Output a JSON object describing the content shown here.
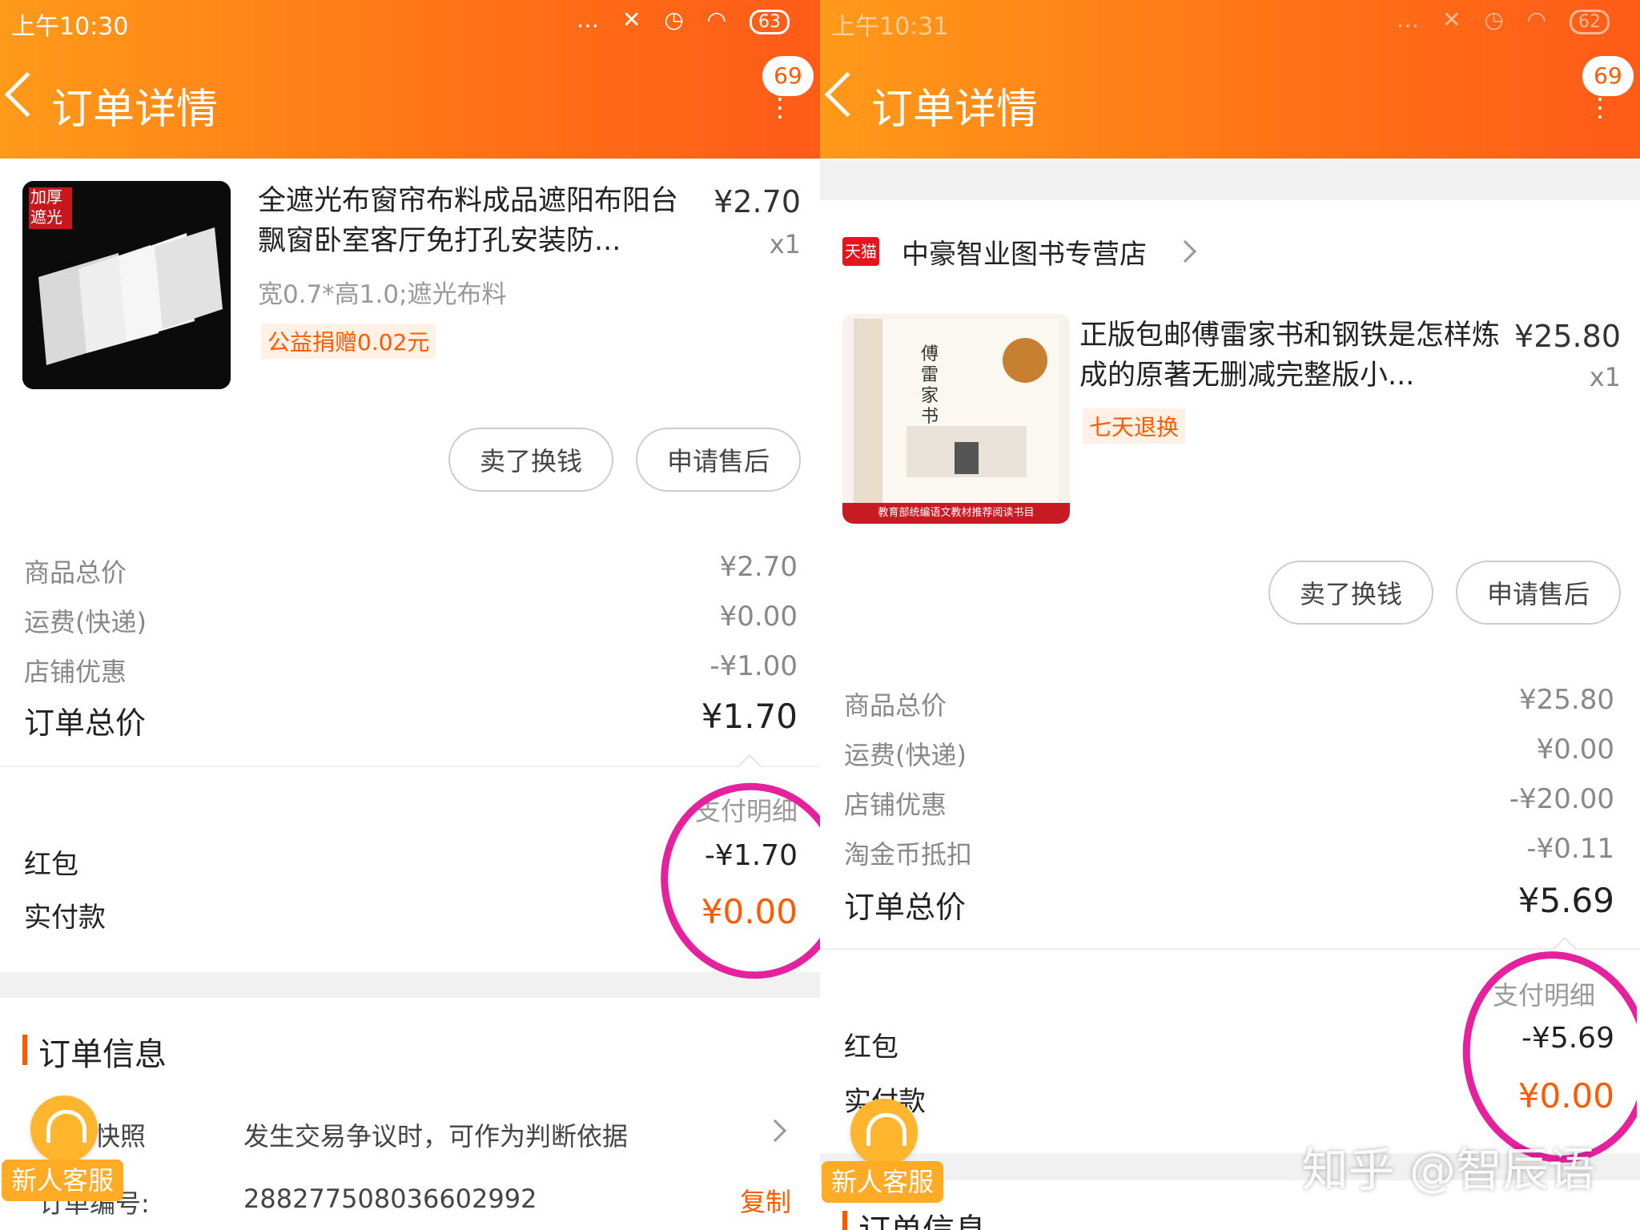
{
  "left": {
    "status": {
      "time": "上午10:30",
      "battery": "63"
    },
    "title": "订单详情",
    "badge": "69",
    "product": {
      "thumb_label": "加厚\n遮光",
      "title": "全遮光布窗帘布料成品遮阳布阳台飘窗卧室客厅免打孔安装防...",
      "price": "¥2.70",
      "qty": "x1",
      "sku": "宽0.7*高1.0;遮光布料",
      "tag": "公益捐赠0.02元"
    },
    "buttons": {
      "sell": "卖了换钱",
      "after_sale": "申请售后"
    },
    "summary": [
      {
        "label": "商品总价",
        "value": "¥2.70"
      },
      {
        "label": "运费(快递)",
        "value": "¥0.00"
      },
      {
        "label": "店铺优惠",
        "value": "-¥1.00"
      }
    ],
    "order_total": {
      "label": "订单总价",
      "value": "¥1.70"
    },
    "pay_detail_label": "支付明细",
    "red_packet": {
      "label": "红包",
      "value": "-¥1.70"
    },
    "actual_pay": {
      "label": "实付款",
      "value": "¥0.00"
    },
    "order_info_title": "订单信息",
    "snapshot": {
      "label": "快照",
      "desc": "发生交易争议时，可作为判断依据"
    },
    "order_no": {
      "label": "订单编号:",
      "value": "2882775080366029​92",
      "copy": "复制"
    },
    "customer_service": "新人客服"
  },
  "right": {
    "status": {
      "time": "上午10:31",
      "battery": "62"
    },
    "title": "订单详情",
    "badge": "69",
    "store": {
      "icon": "天猫",
      "name": "中豪智业图书专营店"
    },
    "product": {
      "title": "正版包邮傅雷家书和钢铁是怎样炼成的原著无删减完整版小...",
      "price": "¥25.80",
      "qty": "x1",
      "tag": "七天退换",
      "book_title": "傅雷家书",
      "book_banner": "教育部统编语文教材推荐阅读书目"
    },
    "buttons": {
      "sell": "卖了换钱",
      "after_sale": "申请售后"
    },
    "summary": [
      {
        "label": "商品总价",
        "value": "¥25.80"
      },
      {
        "label": "运费(快递)",
        "value": "¥0.00"
      },
      {
        "label": "店铺优惠",
        "value": "-¥20.00"
      },
      {
        "label": "淘金币抵扣",
        "value": "-¥0.11"
      }
    ],
    "order_total": {
      "label": "订单总价",
      "value": "¥5.69"
    },
    "pay_detail_label": "支付明细",
    "red_packet": {
      "label": "红包",
      "value": "-¥5.69"
    },
    "actual_pay": {
      "label": "实付款",
      "value": "¥0.00"
    },
    "order_info_title": "订单信息",
    "customer_service": "新人客服"
  },
  "watermark": "知乎 @智辰语",
  "colors": {
    "header_orange": "#ff7416",
    "accent": "#ff5a00",
    "annotation": "#e5219e"
  }
}
